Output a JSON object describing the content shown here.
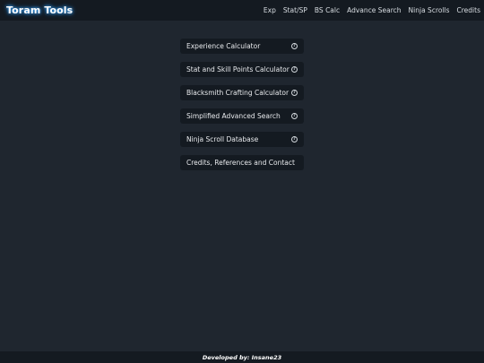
{
  "navbar": {
    "brand": "Toram Tools",
    "links": [
      "Exp",
      "Stat/SP",
      "BS Calc",
      "Advance Search",
      "Ninja Scrolls",
      "Credits"
    ]
  },
  "menu": {
    "items": [
      {
        "label": "Experience Calculator",
        "icon": "help-circle-icon"
      },
      {
        "label": "Stat and Skill Points Calculator",
        "icon": "help-circle-icon"
      },
      {
        "label": "Blacksmith Crafting Calculator",
        "icon": "help-circle-icon"
      },
      {
        "label": "Simplified Advanced Search",
        "icon": "help-circle-icon"
      },
      {
        "label": "Ninja Scroll Database",
        "icon": "help-circle-icon"
      },
      {
        "label": "Credits, References and Contact"
      }
    ]
  },
  "footer": {
    "text": "Developed by: Insane23"
  }
}
